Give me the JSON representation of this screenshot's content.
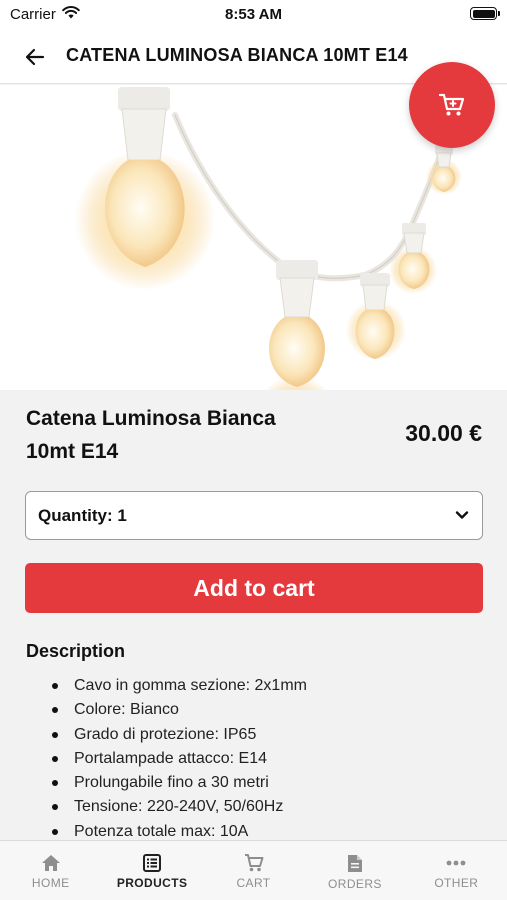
{
  "status_bar": {
    "carrier": "Carrier",
    "time": "8:53 AM"
  },
  "header": {
    "title": "CATENA LUMINOSA BIANCA 10MT E14"
  },
  "product": {
    "name": "Catena Luminosa Bianca 10mt E14",
    "price": "30.00 €",
    "quantity_label": "Quantity: 1",
    "add_to_cart_label": "Add to cart"
  },
  "description": {
    "title": "Description",
    "items": [
      "Cavo in gomma sezione: 2x1mm",
      "Colore: Bianco",
      "Grado di protezione: IP65",
      "Portalampade attacco: E14",
      "Prolungabile fino a 30 metri",
      "Tensione: 220-240V, 50/60Hz",
      "Potenza totale max: 10A"
    ]
  },
  "tabs": [
    {
      "label": "HOME",
      "icon": "home-icon",
      "active": false
    },
    {
      "label": "PRODUCTS",
      "icon": "list-icon",
      "active": true
    },
    {
      "label": "CART",
      "icon": "cart-icon",
      "active": false
    },
    {
      "label": "ORDERS",
      "icon": "document-icon",
      "active": false
    },
    {
      "label": "OTHER",
      "icon": "more-icon",
      "active": false
    }
  ],
  "colors": {
    "accent": "#e53a3d",
    "tab_active": "#222222",
    "tab_inactive": "#8e8e8e"
  }
}
